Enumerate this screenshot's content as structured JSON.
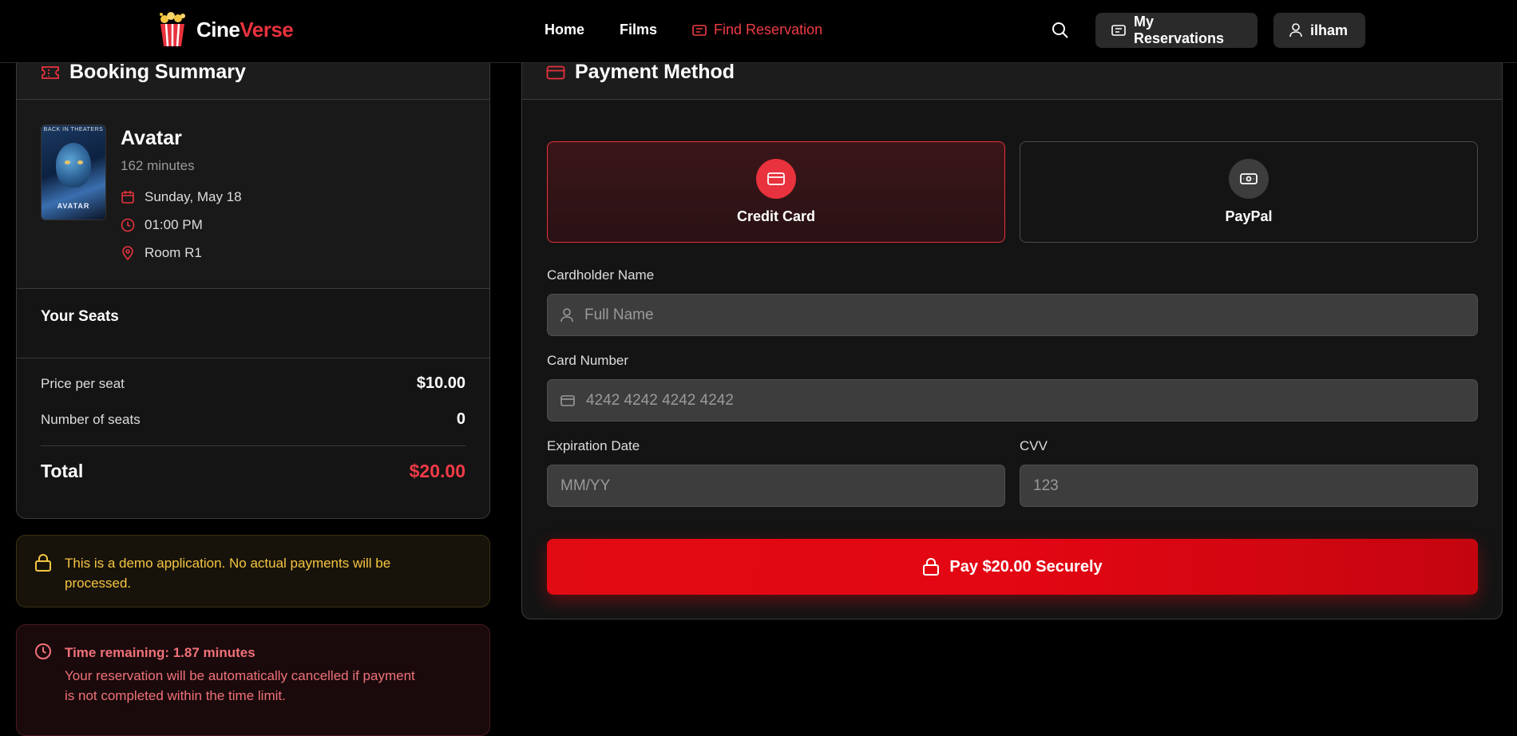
{
  "nav": {
    "brand_white": "Cine",
    "brand_red": "Verse",
    "links": [
      {
        "label": "Home"
      },
      {
        "label": "Films"
      },
      {
        "label": "Find Reservation"
      }
    ],
    "my_reservations": "My Reservations",
    "user": "ilham"
  },
  "summary": {
    "title": "Booking Summary",
    "movie": {
      "poster_top_text": "BACK IN THEATERS",
      "poster_title": "AVATAR",
      "title": "Avatar",
      "duration": "162 minutes",
      "date": "Sunday, May 18",
      "time": "01:00 PM",
      "room": "Room R1"
    },
    "seats_label": "Your Seats",
    "price_per_seat_label": "Price per seat",
    "price_per_seat": "$10.00",
    "num_seats_label": "Number of seats",
    "num_seats": "0",
    "total_label": "Total",
    "total": "$20.00"
  },
  "demo_notice": "This is a demo application. No actual payments will be processed.",
  "timer": {
    "title": "Time remaining: 1.87 minutes",
    "body": "Your reservation will be automatically cancelled if payment is not completed within the time limit."
  },
  "payment": {
    "title": "Payment Method",
    "methods": [
      {
        "label": "Credit Card",
        "selected": true
      },
      {
        "label": "PayPal",
        "selected": false
      }
    ],
    "cardholder_label": "Cardholder Name",
    "cardholder_placeholder": "Full Name",
    "card_number_label": "Card Number",
    "card_number_placeholder": "4242 4242 4242 4242",
    "expiry_label": "Expiration Date",
    "expiry_placeholder": "MM/YY",
    "cvv_label": "CVV",
    "cvv_placeholder": "123",
    "pay_button": "Pay $20.00 Securely"
  },
  "colors": {
    "accent": "#e8323d",
    "background": "#000000",
    "card": "#141414",
    "warning": "#f5c542"
  }
}
